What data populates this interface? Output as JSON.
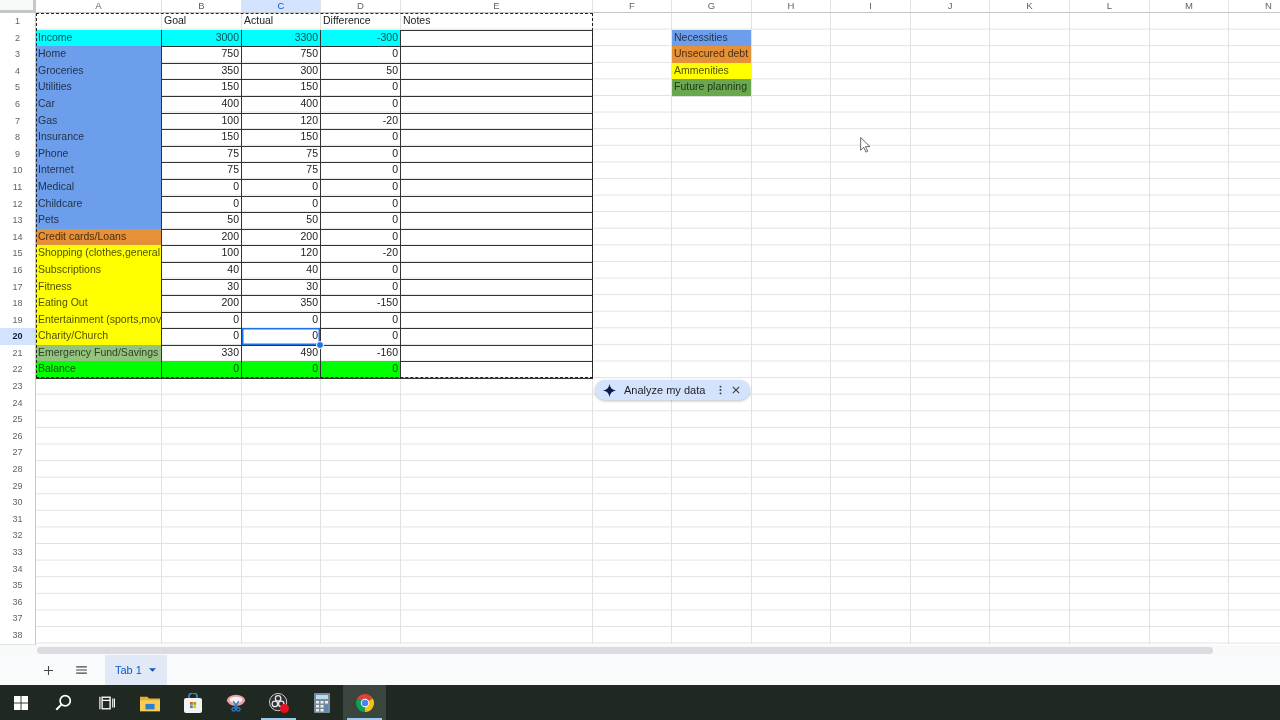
{
  "sheet": {
    "column_headers": [
      {
        "label": "A",
        "selected": false
      },
      {
        "label": "B",
        "selected": false
      },
      {
        "label": "C",
        "selected": true
      },
      {
        "label": "D",
        "selected": false
      },
      {
        "label": "E",
        "selected": false
      },
      {
        "label": "F",
        "selected": false
      },
      {
        "label": "G",
        "selected": false
      },
      {
        "label": "H",
        "selected": false
      },
      {
        "label": "I",
        "selected": false
      },
      {
        "label": "J",
        "selected": false
      },
      {
        "label": "K",
        "selected": false
      },
      {
        "label": "L",
        "selected": false
      },
      {
        "label": "M",
        "selected": false
      },
      {
        "label": "N",
        "selected": false
      }
    ],
    "row_headers": [
      {
        "label": "1",
        "selected": false
      },
      {
        "label": "2",
        "selected": false
      },
      {
        "label": "3",
        "selected": false
      },
      {
        "label": "4",
        "selected": false
      },
      {
        "label": "5",
        "selected": false
      },
      {
        "label": "6",
        "selected": false
      },
      {
        "label": "7",
        "selected": false
      },
      {
        "label": "8",
        "selected": false
      },
      {
        "label": "9",
        "selected": false
      },
      {
        "label": "10",
        "selected": false
      },
      {
        "label": "11",
        "selected": false
      },
      {
        "label": "12",
        "selected": false
      },
      {
        "label": "13",
        "selected": false
      },
      {
        "label": "14",
        "selected": false
      },
      {
        "label": "15",
        "selected": false
      },
      {
        "label": "16",
        "selected": false
      },
      {
        "label": "17",
        "selected": false
      },
      {
        "label": "18",
        "selected": false
      },
      {
        "label": "19",
        "selected": false
      },
      {
        "label": "20",
        "selected": true
      },
      {
        "label": "21",
        "selected": false
      },
      {
        "label": "22",
        "selected": false
      },
      {
        "label": "23",
        "selected": false
      },
      {
        "label": "24",
        "selected": false
      },
      {
        "label": "25",
        "selected": false
      },
      {
        "label": "26",
        "selected": false
      },
      {
        "label": "27",
        "selected": false
      },
      {
        "label": "28",
        "selected": false
      },
      {
        "label": "29",
        "selected": false
      },
      {
        "label": "30",
        "selected": false
      },
      {
        "label": "31",
        "selected": false
      },
      {
        "label": "32",
        "selected": false
      },
      {
        "label": "33",
        "selected": false
      },
      {
        "label": "34",
        "selected": false
      },
      {
        "label": "35",
        "selected": false
      },
      {
        "label": "36",
        "selected": false
      },
      {
        "label": "37",
        "selected": false
      },
      {
        "label": "38",
        "selected": false
      }
    ],
    "header_cells": [
      "Goal",
      "Actual",
      "Difference",
      "Notes"
    ],
    "rows": [
      {
        "column_a": "Income",
        "color": "#00ffff",
        "highlighted": true,
        "goal": "3000",
        "actual": "3300",
        "difference": "-300"
      },
      {
        "column_a": "Home",
        "color": "#6d9eeb",
        "highlighted": false,
        "goal": "750",
        "actual": "750",
        "difference": "0"
      },
      {
        "column_a": "Groceries",
        "color": "#6d9eeb",
        "highlighted": false,
        "goal": "350",
        "actual": "300",
        "difference": "50"
      },
      {
        "column_a": "Utilities",
        "color": "#6d9eeb",
        "highlighted": false,
        "goal": "150",
        "actual": "150",
        "difference": "0"
      },
      {
        "column_a": "Car",
        "color": "#6d9eeb",
        "highlighted": false,
        "goal": "400",
        "actual": "400",
        "difference": "0"
      },
      {
        "column_a": "Gas",
        "color": "#6d9eeb",
        "highlighted": false,
        "goal": "100",
        "actual": "120",
        "difference": "-20"
      },
      {
        "column_a": "Insurance",
        "color": "#6d9eeb",
        "highlighted": false,
        "goal": "150",
        "actual": "150",
        "difference": "0"
      },
      {
        "column_a": "Phone",
        "color": "#6d9eeb",
        "highlighted": false,
        "goal": "75",
        "actual": "75",
        "difference": "0"
      },
      {
        "column_a": "Internet",
        "color": "#6d9eeb",
        "highlighted": false,
        "goal": "75",
        "actual": "75",
        "difference": "0"
      },
      {
        "column_a": "Medical",
        "color": "#6d9eeb",
        "highlighted": false,
        "goal": "0",
        "actual": "0",
        "difference": "0"
      },
      {
        "column_a": "Childcare",
        "color": "#6d9eeb",
        "highlighted": false,
        "goal": "0",
        "actual": "0",
        "difference": "0"
      },
      {
        "column_a": "Pets",
        "color": "#6d9eeb",
        "highlighted": false,
        "goal": "50",
        "actual": "50",
        "difference": "0"
      },
      {
        "column_a": "Credit cards/Loans",
        "color": "#e69138",
        "highlighted": false,
        "goal": "200",
        "actual": "200",
        "difference": "0"
      },
      {
        "column_a": "Shopping (clothes,general",
        "color": "#ffff00",
        "highlighted": false,
        "goal": "100",
        "actual": "120",
        "difference": "-20"
      },
      {
        "column_a": "Subscriptions",
        "color": "#ffff00",
        "highlighted": false,
        "goal": "40",
        "actual": "40",
        "difference": "0"
      },
      {
        "column_a": "Fitness",
        "color": "#ffff00",
        "highlighted": false,
        "goal": "30",
        "actual": "30",
        "difference": "0"
      },
      {
        "column_a": "Eating Out",
        "color": "#ffff00",
        "highlighted": false,
        "goal": "200",
        "actual": "350",
        "difference": "-150"
      },
      {
        "column_a": "Entertainment (sports,mov",
        "color": "#ffff00",
        "highlighted": false,
        "goal": "0",
        "actual": "0",
        "difference": "0"
      },
      {
        "column_a": "Charity/Church",
        "color": "#ffff00",
        "highlighted": false,
        "goal": "0",
        "actual": "0",
        "difference": "0"
      },
      {
        "column_a": "Emergency Fund/Savings",
        "color": "#93c47d",
        "highlighted": false,
        "goal": "330",
        "actual": "490",
        "difference": "-160"
      },
      {
        "column_a": "Balance",
        "color": "#00ff00",
        "highlighted": true,
        "goal": "0",
        "actual": "0",
        "difference": "0"
      }
    ],
    "legend": [
      {
        "label": "Necessities",
        "color": "#6d9eeb"
      },
      {
        "label": "Unsecured debt",
        "color": "#e69138"
      },
      {
        "label": "Ammenities",
        "color": "#ffff00"
      },
      {
        "label": "Future planning",
        "color": "#6aa84f"
      }
    ],
    "copied_range": true
  },
  "assistant_chip": {
    "label": "Analyze my data"
  },
  "sheet_tabs": [
    {
      "label": "Tab 1",
      "selected": true
    }
  ],
  "taskbar": {
    "apps": [
      {
        "running": false,
        "selected": false
      },
      {
        "running": false,
        "selected": false
      },
      {
        "running": false,
        "selected": false
      },
      {
        "running": true,
        "selected": false
      },
      {
        "running": false,
        "selected": false
      },
      {
        "running": true,
        "selected": true
      }
    ]
  }
}
